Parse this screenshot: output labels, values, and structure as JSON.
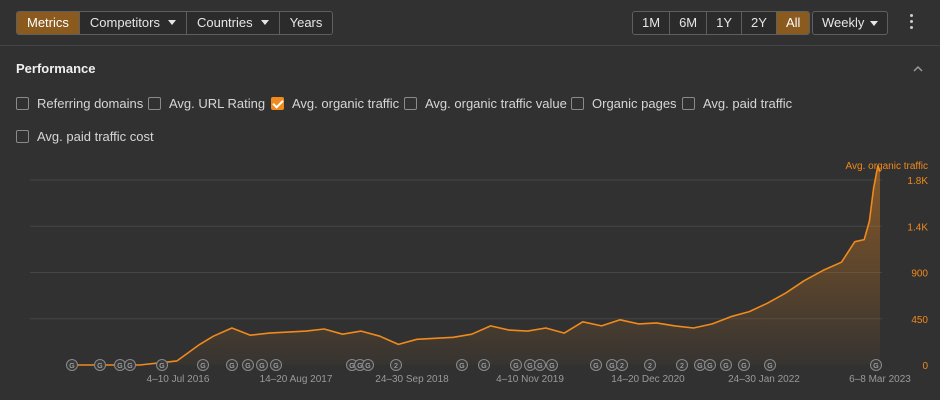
{
  "toolbar": {
    "tabs": [
      {
        "label": "Metrics",
        "active": true,
        "dropdown": false
      },
      {
        "label": "Competitors",
        "active": false,
        "dropdown": true
      },
      {
        "label": "Countries",
        "active": false,
        "dropdown": true
      },
      {
        "label": "Years",
        "active": false,
        "dropdown": false
      }
    ],
    "periods": [
      {
        "label": "1M",
        "active": false
      },
      {
        "label": "6M",
        "active": false
      },
      {
        "label": "1Y",
        "active": false
      },
      {
        "label": "2Y",
        "active": false
      },
      {
        "label": "All",
        "active": true
      }
    ],
    "interval": "Weekly",
    "more_icon": "kebab-icon"
  },
  "section": {
    "title": "Performance",
    "collapse_icon": "chevron-up-icon"
  },
  "metrics": [
    {
      "label": "Referring domains",
      "checked": false
    },
    {
      "label": "Avg. URL Rating",
      "checked": false
    },
    {
      "label": "Avg. organic traffic",
      "checked": true
    },
    {
      "label": "Avg. organic traffic value",
      "checked": false
    },
    {
      "label": "Organic pages",
      "checked": false
    },
    {
      "label": "Avg. paid traffic",
      "checked": false
    },
    {
      "label": "Avg. paid traffic cost",
      "checked": false
    }
  ],
  "colors": {
    "accent": "#f08a1c",
    "background": "#313131",
    "grid": "#454545",
    "tick_text": "#f08a1c",
    "x_tick_text": "#9a9a9a"
  },
  "chart_data": {
    "type": "area",
    "series": [
      {
        "name": "Avg. organic traffic",
        "x": [
          "2015-11-01",
          "2016-03-01",
          "2016-07-01",
          "2016-11-01",
          "2017-01-15",
          "2017-03-01",
          "2017-05-01",
          "2017-07-01",
          "2017-09-01",
          "2017-11-01",
          "2018-01-01",
          "2018-03-01",
          "2018-05-01",
          "2018-07-01",
          "2018-09-01",
          "2018-11-01",
          "2019-01-01",
          "2019-03-01",
          "2019-05-01",
          "2019-07-01",
          "2019-09-01",
          "2019-11-01",
          "2020-01-01",
          "2020-03-01",
          "2020-05-01",
          "2020-07-01",
          "2020-09-01",
          "2020-11-01",
          "2021-01-01",
          "2021-03-01",
          "2021-05-01",
          "2021-07-01",
          "2021-09-01",
          "2021-11-01",
          "2022-01-01",
          "2022-03-01",
          "2022-05-01",
          "2022-07-01",
          "2022-09-01",
          "2022-11-01",
          "2022-12-15",
          "2023-01-15",
          "2023-02-01",
          "2023-02-15",
          "2023-03-01",
          "2023-03-08"
        ],
        "values": [
          0,
          0,
          0,
          40,
          200,
          280,
          360,
          290,
          310,
          320,
          330,
          350,
          300,
          330,
          280,
          200,
          250,
          260,
          270,
          300,
          380,
          340,
          330,
          360,
          310,
          420,
          380,
          440,
          400,
          410,
          380,
          360,
          400,
          470,
          520,
          600,
          700,
          820,
          920,
          1000,
          1200,
          1220,
          1400,
          1720,
          1940,
          1880
        ]
      }
    ],
    "x_ticks": [
      "4–10 Jul 2016",
      "14–20 Aug 2017",
      "24–30 Sep 2018",
      "4–10 Nov 2019",
      "14–20 Dec 2020",
      "24–30 Jan 2022",
      "6–8 Mar 2023"
    ],
    "y_ticks": [
      0,
      450,
      900,
      "1.4K",
      "1.8K"
    ],
    "y_tick_values": [
      0,
      450,
      900,
      1350,
      1800
    ],
    "ylim": [
      0,
      1800
    ],
    "grid": true,
    "legend_label": "Avg. organic traffic",
    "legend_placement": "top-right",
    "annotation_markers": [
      "G",
      "G",
      "G",
      "G",
      "G",
      "G",
      "G",
      "G",
      "G",
      "G",
      "G",
      "G",
      "G",
      "2",
      "G",
      "G",
      "G",
      "G",
      "G",
      "G",
      "G",
      "G",
      "2",
      "2",
      "2",
      "G",
      "G",
      "G",
      "G",
      "G",
      "G"
    ]
  }
}
